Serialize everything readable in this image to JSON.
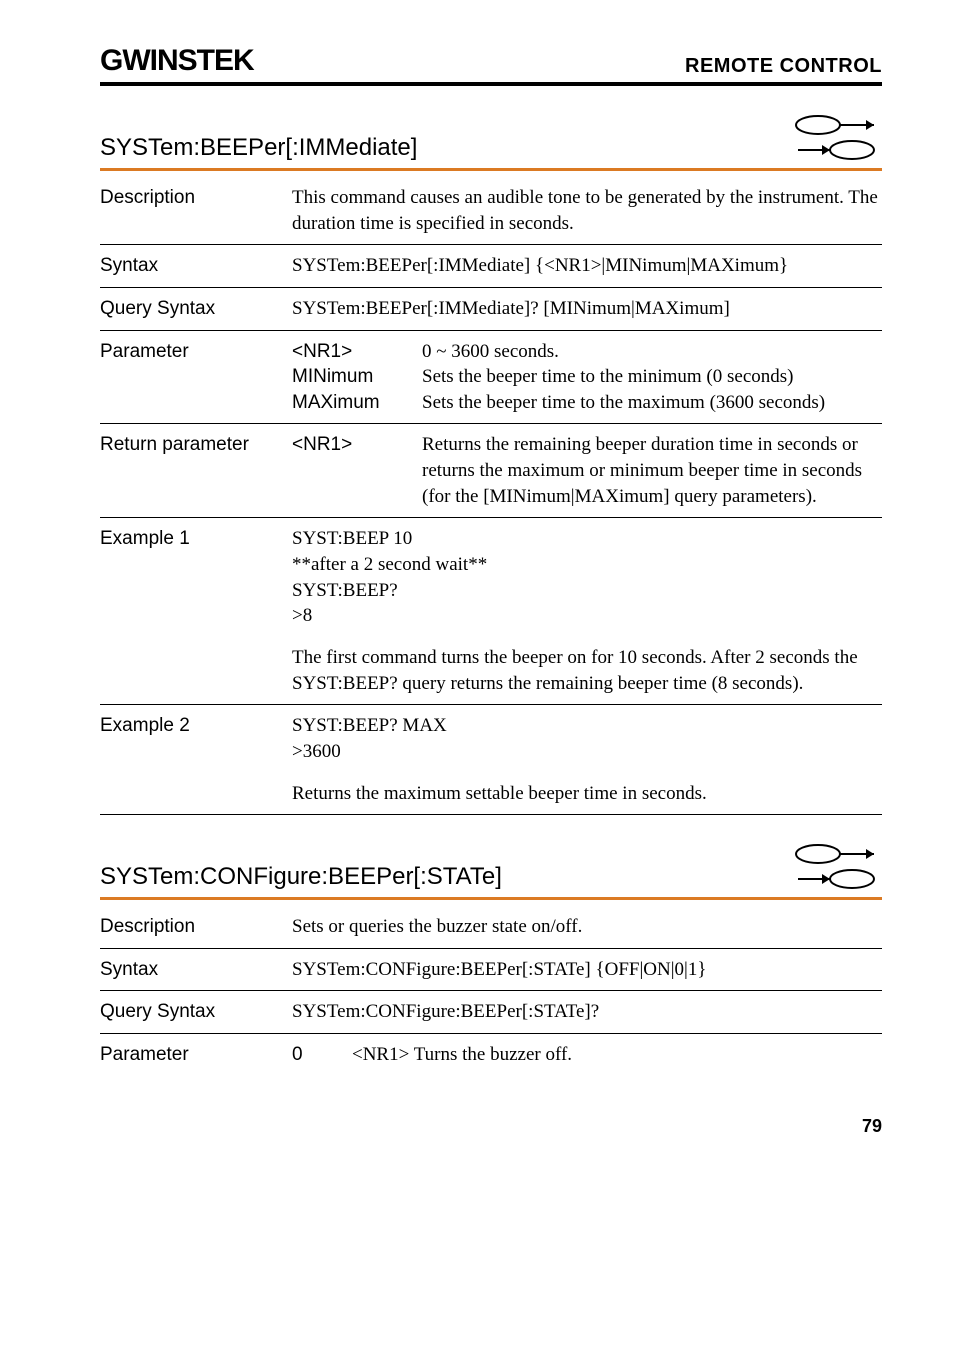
{
  "header": {
    "logo": "GWINSTEK",
    "section": "REMOTE CONTROL"
  },
  "cmd1": {
    "title": "SYSTem:BEEPer[:IMMediate]",
    "rows": {
      "desc_label": "Description",
      "desc_text": "This command causes an audible tone to be generated by the instrument. The duration time is specified in seconds.",
      "syntax_label": "Syntax",
      "syntax_text": "SYSTem:BEEPer[:IMMediate] {<NR1>|MINimum|MAXimum}",
      "qsyntax_label": "Query Syntax",
      "qsyntax_text": "SYSTem:BEEPer[:IMMediate]? [MINimum|MAXimum]",
      "param_label": "Parameter",
      "param": {
        "nr1_name": "<NR1>",
        "nr1_desc": "0 ~ 3600 seconds.",
        "min_name": "MINimum",
        "min_desc": "Sets the beeper time to the minimum (0 seconds)",
        "max_name": "MAXimum",
        "max_desc": "Sets the beeper time to the maximum (3600 seconds)"
      },
      "ret_label": "Return parameter",
      "ret_name": "<NR1>",
      "ret_desc": "Returns the remaining beeper duration time in seconds or returns the maximum or minimum beeper time in seconds (for the [MINimum|MAXimum] query parameters).",
      "ex1_label": "Example 1",
      "ex1_lines": "SYST:BEEP 10\n**after a 2 second wait**\nSYST:BEEP?\n>8",
      "ex1_note": "The first command turns the beeper on for 10 seconds. After 2 seconds the SYST:BEEP? query returns the remaining beeper time (8 seconds).",
      "ex2_label": "Example 2",
      "ex2_lines": "SYST:BEEP? MAX\n>3600",
      "ex2_note": "Returns the maximum settable beeper time in seconds."
    }
  },
  "cmd2": {
    "title": "SYSTem:CONFigure:BEEPer[:STATe]",
    "rows": {
      "desc_label": "Description",
      "desc_text": "Sets or queries the buzzer state on/off.",
      "syntax_label": "Syntax",
      "syntax_text": "SYSTem:CONFigure:BEEPer[:STATe] {OFF|ON|0|1}",
      "qsyntax_label": "Query Syntax",
      "qsyntax_text": "SYSTem:CONFigure:BEEPer[:STATe]?",
      "param_label": "Parameter",
      "param_name": "0",
      "param_desc": "<NR1> Turns the buzzer off."
    }
  },
  "pagenum": "79"
}
